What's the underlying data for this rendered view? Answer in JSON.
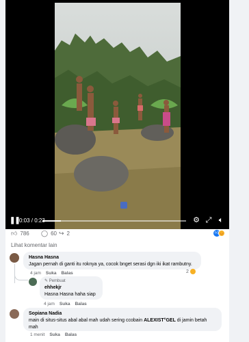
{
  "video": {
    "time_display": "0:03 / 0:23",
    "progress": 0.13
  },
  "reactions": {
    "likes": "786",
    "comments": "60",
    "shares": "2"
  },
  "comments_section": {
    "more_label": "Lihat komentar lain"
  },
  "comments": [
    {
      "author": "Hasna Hasna",
      "text": "Jagan pernah di ganti itu roknya ya, cocok bnget serasi dgn iki ikat rambutny.",
      "time": "4 jam",
      "like_label": "Suka",
      "reply_label": "Balas",
      "reaction_count": "2"
    },
    {
      "badge": "Pembuat",
      "author": "ehhekjr",
      "text": "Hasna Hasna haha siap",
      "time": "4 jam",
      "like_label": "Suka",
      "reply_label": "Balas"
    },
    {
      "author": "Sopiana Nadia",
      "text_before": "main di situs-situs abal abal mah udah sering ccobain ",
      "text_bold": "ALEXIST°GEL",
      "text_after": " di jamin betah mah",
      "time": "1 menit",
      "like_label": "Suka",
      "reply_label": "Balas"
    }
  ],
  "icons": {
    "play": "pause-icon",
    "settings": "gear-icon",
    "fullscreen": "expand-icon",
    "volume": "volume-icon",
    "like": "thumbs-up-icon",
    "comment": "comment-icon",
    "share": "share-icon"
  },
  "colors": {
    "like_badge": "#1877f2",
    "haha_badge": "#f7b125",
    "bubble": "#f0f2f5",
    "secondary_text": "#65676b"
  }
}
